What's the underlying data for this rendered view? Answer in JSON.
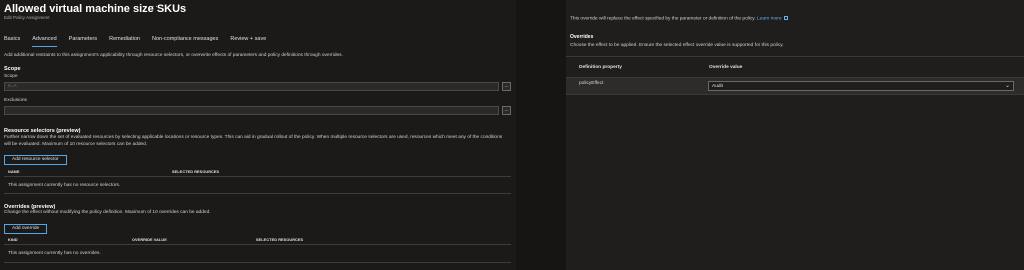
{
  "header": {
    "title": "Allowed virtual machine size SKUs",
    "more": "···",
    "subtitle": "Edit Policy Assignment"
  },
  "tabs": [
    {
      "label": "Basics"
    },
    {
      "label": "Advanced",
      "active": true
    },
    {
      "label": "Parameters"
    },
    {
      "label": "Remediation"
    },
    {
      "label": "Non-compliance messages"
    },
    {
      "label": "Review + save"
    }
  ],
  "advanced": {
    "description": "Add additional restraints to this assignment's applicability through resource selectors, or overwrite effects of parameters and policy definitions through overrides."
  },
  "scope": {
    "heading": "Scope",
    "label": "Scope",
    "value": "0..A",
    "browse": "..."
  },
  "exclusions": {
    "label": "Exclusions",
    "value": "",
    "browse": "..."
  },
  "resource_selectors": {
    "heading": "Resource selectors (preview)",
    "description": "Further narrow down the set of evaluated resources by selecting applicable locations or resource types. This can aid in gradual rollout of the policy. When multiple resource selectors are used, resources which meet any of the conditions will be evaluated. Maximum of 10 resource selectors can be added.",
    "add_button": "Add resource selector",
    "columns": [
      "NAME",
      "SELECTED RESOURCES"
    ],
    "empty": "This assignment currently has no resource selectors."
  },
  "overrides": {
    "heading": "Overrides (preview)",
    "description": "Change the effect without modifying the policy definition. Maximum of 10 overrides can be added.",
    "add_button": "Add override",
    "columns": [
      "KIND",
      "OVERRIDE VALUE",
      "SELECTED RESOURCES"
    ],
    "empty": "This assignment currently has no overrides."
  },
  "panel": {
    "intro": "This override will replace the effect specified by the parameter or definition of the policy.",
    "learn_more": "Learn more",
    "section_title": "Overrides",
    "section_desc": "Choose the effect to be applied. Ensure the selected effect override value is supported for this policy.",
    "col_definition": "Definition property",
    "col_value": "Override value",
    "row": {
      "property": "policyEffect",
      "value": "Audit"
    }
  },
  "colors": {
    "accent": "#4fa8e8",
    "link": "#69afe5",
    "background": "#1b1a19"
  }
}
